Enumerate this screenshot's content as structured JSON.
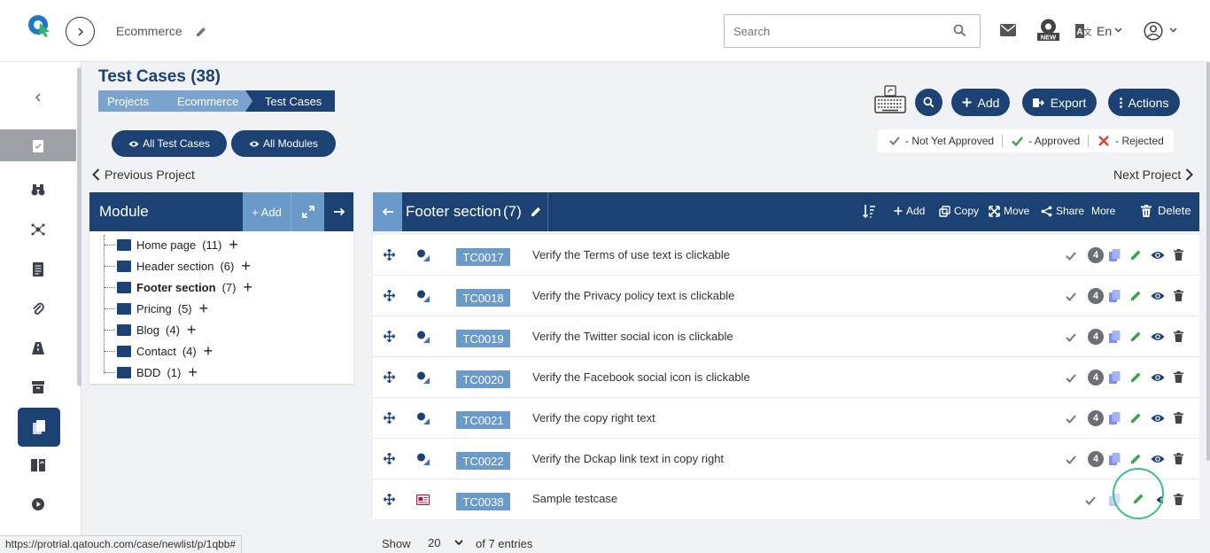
{
  "header": {
    "project_name": "Ecommerce",
    "search_placeholder": "Search",
    "language": "En"
  },
  "page": {
    "title": "Test Cases (38)",
    "breadcrumbs": [
      "Projects",
      "Ecommerce",
      "Test Cases"
    ]
  },
  "toolbar": {
    "add_label": "Add",
    "export_label": "Export",
    "actions_label": "Actions"
  },
  "filters": {
    "all_test_cases": "All Test Cases",
    "all_modules": "All Modules"
  },
  "legend": {
    "not_yet_approved": "- Not Yet Approved",
    "approved": "- Approved",
    "rejected": "- Rejected"
  },
  "nav": {
    "previous_project": "Previous Project",
    "next_project": "Next Project"
  },
  "module_panel": {
    "title": "Module",
    "add_label": "+ Add",
    "modules": [
      {
        "name": "Home page",
        "count": "(11)"
      },
      {
        "name": "Header section",
        "count": "(6)"
      },
      {
        "name": "Footer section",
        "count": "(7)"
      },
      {
        "name": "Pricing",
        "count": "(5)"
      },
      {
        "name": "Blog",
        "count": "(4)"
      },
      {
        "name": "Contact",
        "count": "(4)"
      },
      {
        "name": "BDD",
        "count": "(1)"
      }
    ]
  },
  "case_panel": {
    "module_title": "Footer section",
    "module_count": "(7)",
    "actions": {
      "add": "Add",
      "copy": "Copy",
      "move": "Move",
      "share": "Share",
      "more": "More",
      "delete": "Delete"
    },
    "rows": [
      {
        "id": "TC0017",
        "title": "Verify the Terms of use text is clickable",
        "badge": "4"
      },
      {
        "id": "TC0018",
        "title": "Verify the Privacy policy text is clickable",
        "badge": "4"
      },
      {
        "id": "TC0019",
        "title": "Verify the Twitter social icon is clickable",
        "badge": "4"
      },
      {
        "id": "TC0020",
        "title": "Verify the Facebook social icon is clickable",
        "badge": "4"
      },
      {
        "id": "TC0021",
        "title": "Verify the copy right text",
        "badge": "4"
      },
      {
        "id": "TC0022",
        "title": "Verify the Dckap link text in copy right",
        "badge": "4"
      },
      {
        "id": "TC0038",
        "title": "Sample testcase",
        "badge": ""
      }
    ]
  },
  "pagination": {
    "show_label": "Show",
    "per_page": "20",
    "entries_label": "of 7 entries"
  },
  "status_url": "https://protrial.qatouch.com/case/newlist/p/1qbb#",
  "colors": {
    "brand": "#1c4173",
    "id_badge": "#6a9ac9",
    "breadcrumb_light": "#7aa3d0",
    "approved_green": "#3fa34d",
    "rejected_red": "#e0403a",
    "highlight_circle": "#3dbf86"
  }
}
